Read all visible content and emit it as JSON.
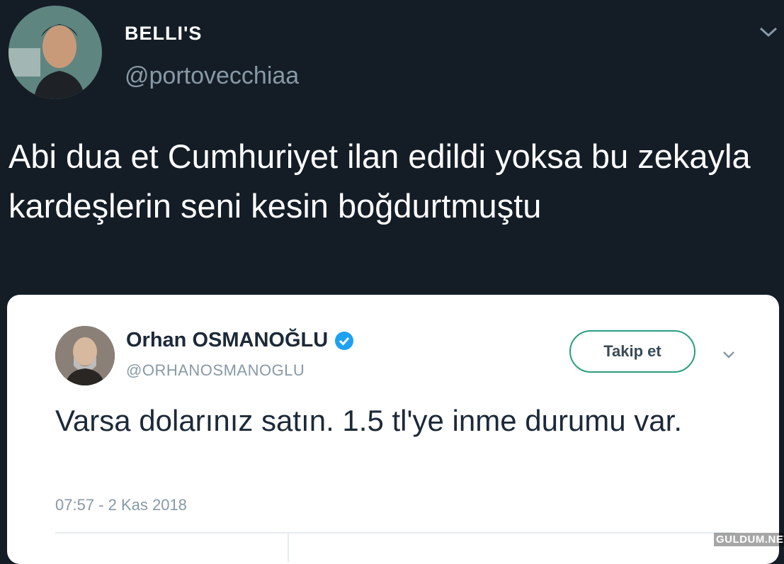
{
  "outer_tweet": {
    "display_name": "BELLI'S",
    "handle": "@portovecchiaa",
    "text": "Abi dua et Cumhuriyet ilan edildi yoksa bu zekayla kardeşlerin seni kesin boğdurtmuştu",
    "menu_icon": "chevron-down-icon"
  },
  "embedded_tweet": {
    "display_name": "Orhan OSMANOĞLU",
    "verified_icon": "verified-badge-icon",
    "handle": "@ORHANOSMANOGLU",
    "follow_label": "Takip et",
    "text": "Varsa dolarınız satın. 1.5 tl'ye inme durumu var.",
    "timestamp": "07:57 - 2 Kas 2018",
    "menu_icon": "chevron-down-icon"
  },
  "watermark": "GULDUM.NET",
  "colors": {
    "background": "#141d26",
    "card": "#ffffff",
    "verified": "#1da1f2",
    "follow_border": "#2a9d7d",
    "muted": "#8899a6"
  }
}
